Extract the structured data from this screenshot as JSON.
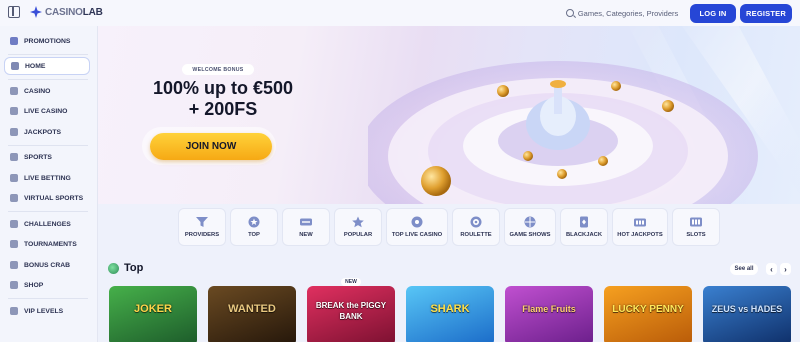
{
  "header": {
    "logo_prefix": "CASINO",
    "logo_suffix": "LAB",
    "search_placeholder": "Games, Categories, Providers",
    "login_label": "LOG IN",
    "register_label": "REGISTER"
  },
  "sidebar": {
    "items": [
      {
        "label": "PROMOTIONS",
        "icon": "gift-icon"
      },
      {
        "label": "HOME",
        "icon": "home-icon",
        "active": true
      },
      {
        "label": "CASINO",
        "icon": "slot-icon"
      },
      {
        "label": "LIVE CASINO",
        "icon": "live-icon"
      },
      {
        "label": "JACKPOTS",
        "icon": "jackpot-icon"
      },
      {
        "label": "SPORTS",
        "icon": "sports-icon"
      },
      {
        "label": "LIVE BETTING",
        "icon": "live-betting-icon"
      },
      {
        "label": "VIRTUAL SPORTS",
        "icon": "virtual-sports-icon"
      },
      {
        "label": "CHALLENGES",
        "icon": "challenges-icon"
      },
      {
        "label": "TOURNAMENTS",
        "icon": "trophy-icon"
      },
      {
        "label": "BONUS CRAB",
        "icon": "crab-icon"
      },
      {
        "label": "SHOP",
        "icon": "shop-icon"
      },
      {
        "label": "VIP LEVELS",
        "icon": "vip-icon"
      }
    ]
  },
  "hero": {
    "badge": "WELCOME BONUS",
    "title_line1": "100% up to €500",
    "title_line2": "+ 200FS",
    "cta": "JOIN NOW"
  },
  "categories": [
    {
      "label": "PROVIDERS",
      "icon": "filter-icon"
    },
    {
      "label": "TOP",
      "icon": "star-badge-icon"
    },
    {
      "label": "NEW",
      "icon": "new-tag-icon"
    },
    {
      "label": "POPULAR",
      "icon": "star-icon"
    },
    {
      "label": "TOP LIVE CASINO",
      "icon": "live-star-icon"
    },
    {
      "label": "ROULETTE",
      "icon": "roulette-icon"
    },
    {
      "label": "GAME SHOWS",
      "icon": "game-show-icon"
    },
    {
      "label": "BLACKJACK",
      "icon": "cards-icon"
    },
    {
      "label": "HOT JACKPOTS",
      "icon": "hot-jackpot-icon"
    },
    {
      "label": "SLOTS",
      "icon": "slots-icon"
    }
  ],
  "top_section": {
    "title": "Top",
    "see_all": "See all",
    "prev": "‹",
    "next": "›",
    "new_badge": "NEW",
    "games": [
      {
        "title": "JOKER",
        "bg": "#2a7a3a"
      },
      {
        "title": "WANTED",
        "bg": "#3a2614"
      },
      {
        "title": "BREAK the PIGGY BANK",
        "bg": "#c8205a"
      },
      {
        "title": "SHARK",
        "bg": "#1e8ad8"
      },
      {
        "title": "Flame Fruits",
        "bg": "#a83aa8"
      },
      {
        "title": "LUCKY PENNY",
        "bg": "#e07a12"
      },
      {
        "title": "ZEUS vs HADES",
        "bg": "#1e5aa8"
      }
    ]
  },
  "colors": {
    "primary": "#2646d6",
    "cta": "#f6a914",
    "sidebar_bg": "#f3f5fc"
  }
}
